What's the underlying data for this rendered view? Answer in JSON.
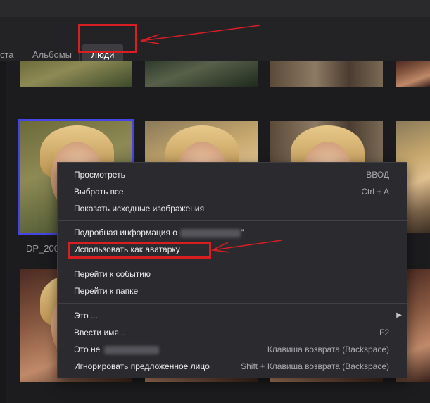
{
  "tabs": [
    {
      "label": "ста"
    },
    {
      "label": "Альбомы"
    },
    {
      "label": "Люди"
    }
  ],
  "photo_caption": "DP_200",
  "menu": {
    "view": {
      "label": "Просмотреть",
      "shortcut": "ВВОД"
    },
    "select_all": {
      "label": "Выбрать все",
      "shortcut": "Ctrl + A"
    },
    "show_source": {
      "label": "Показать исходные изображения"
    },
    "details": {
      "label": "Подробная информация о",
      "suffix": "\""
    },
    "use_as_avatar": {
      "label": "Использовать как аватарку"
    },
    "go_to_event": {
      "label": "Перейти к событию"
    },
    "go_to_folder": {
      "label": "Перейти к папке"
    },
    "this_is": {
      "label": "Это ..."
    },
    "enter_name": {
      "label": "Ввести имя...",
      "shortcut": "F2"
    },
    "not_this": {
      "label": "Это не",
      "shortcut": "Клавиша возврата (Backspace)"
    },
    "ignore_face": {
      "label": "Игнорировать предложенное лицо",
      "shortcut": "Shift + Клавиша возврата (Backspace)"
    }
  },
  "colors": {
    "annotation_red": "#d81e23",
    "selection_blue": "#4545e6",
    "menu_bg": "#2b2b2f"
  }
}
